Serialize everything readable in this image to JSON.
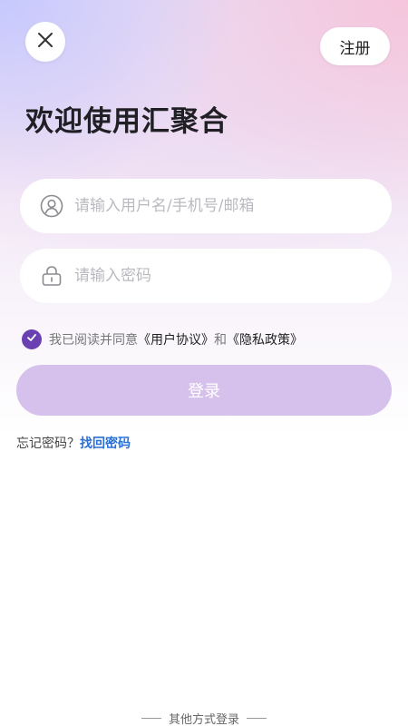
{
  "header": {
    "close_icon": "close-icon",
    "register_label": "注册"
  },
  "title": "欢迎使用汇聚合",
  "form": {
    "username": {
      "icon": "user-icon",
      "placeholder": "请输入用户名/手机号/邮箱",
      "value": ""
    },
    "password": {
      "icon": "lock-icon",
      "placeholder": "请输入密码",
      "value": ""
    }
  },
  "agreement": {
    "checked": true,
    "prefix": "我已阅读并同意",
    "user_agreement": "《用户协议》",
    "conjunction": "和",
    "privacy_policy": "《隐私政策》"
  },
  "login_label": "登录",
  "forgot": {
    "question": "忘记密码？",
    "retrieve_label": "找回密码"
  },
  "other_login_label": "其他方式登录",
  "colors": {
    "accent": "#6a3fb2",
    "login_button": "#d6c1ec",
    "link": "#2a6fd6"
  }
}
